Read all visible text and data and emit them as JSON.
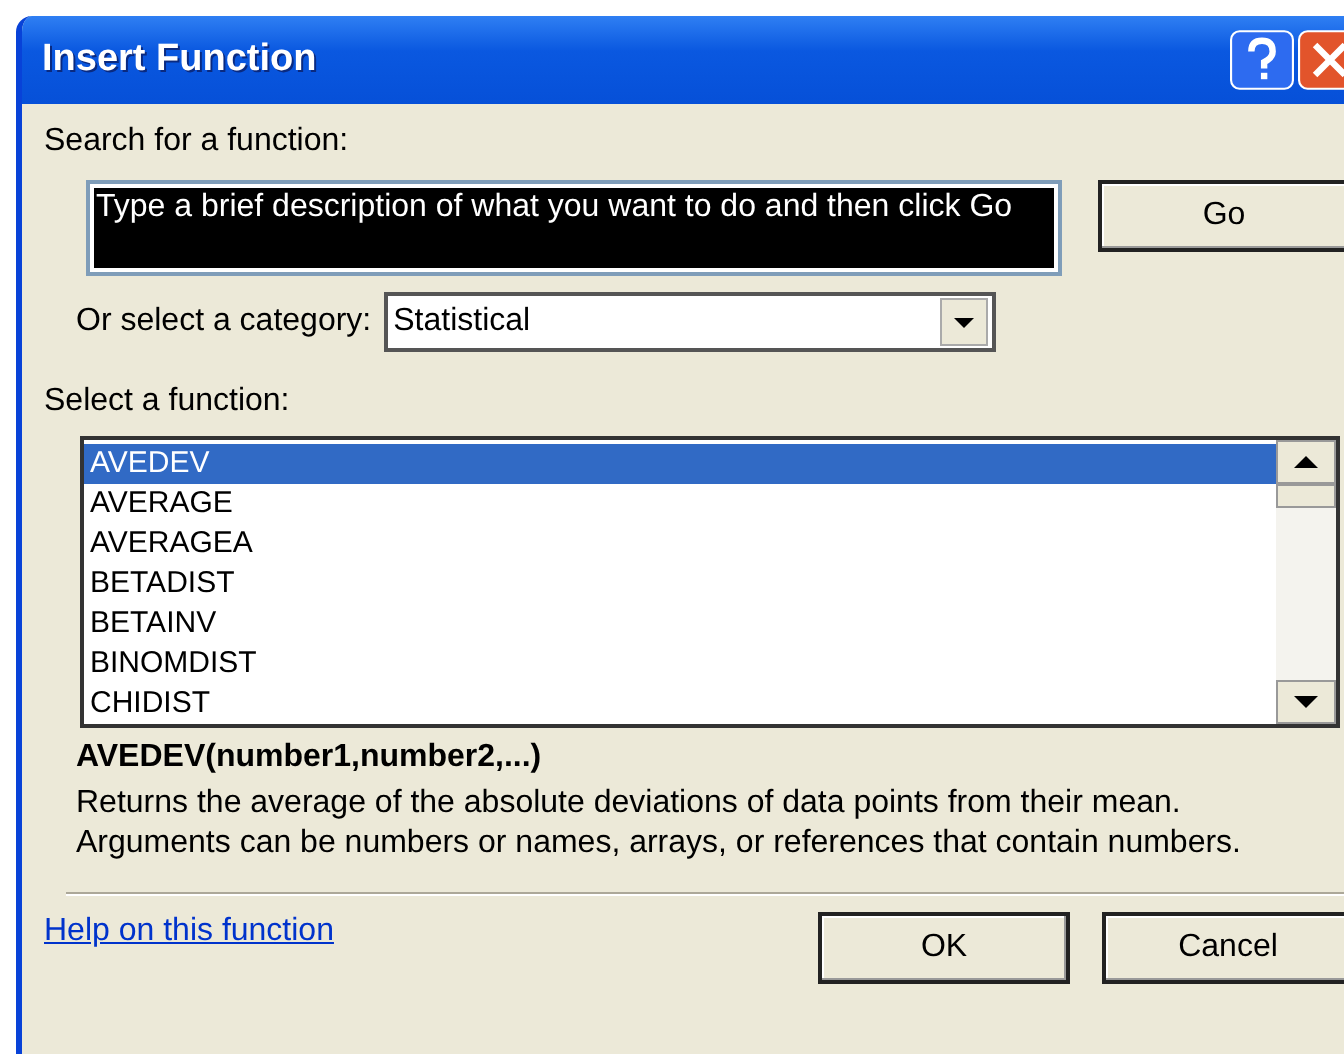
{
  "window": {
    "title": "Insert Function"
  },
  "search": {
    "label": "Search for a function:",
    "value": "Type a brief description of what you want to do and then click Go",
    "selected": true,
    "button": "Go"
  },
  "category": {
    "label": "Or select a category:",
    "value": "Statistical"
  },
  "functions": {
    "label": "Select a function:",
    "items": [
      {
        "name": "AVEDEV",
        "selected": true
      },
      {
        "name": "AVERAGE",
        "selected": false
      },
      {
        "name": "AVERAGEA",
        "selected": false
      },
      {
        "name": "BETADIST",
        "selected": false
      },
      {
        "name": "BETAINV",
        "selected": false
      },
      {
        "name": "BINOMDIST",
        "selected": false
      },
      {
        "name": "CHIDIST",
        "selected": false
      }
    ]
  },
  "signature": "AVEDEV(number1,number2,...)",
  "description": "Returns the average of the absolute deviations of data points from their mean. Arguments can be numbers or names, arrays, or references that contain numbers.",
  "help_link": "Help on this function",
  "buttons": [
    "OK",
    "Cancel"
  ]
}
